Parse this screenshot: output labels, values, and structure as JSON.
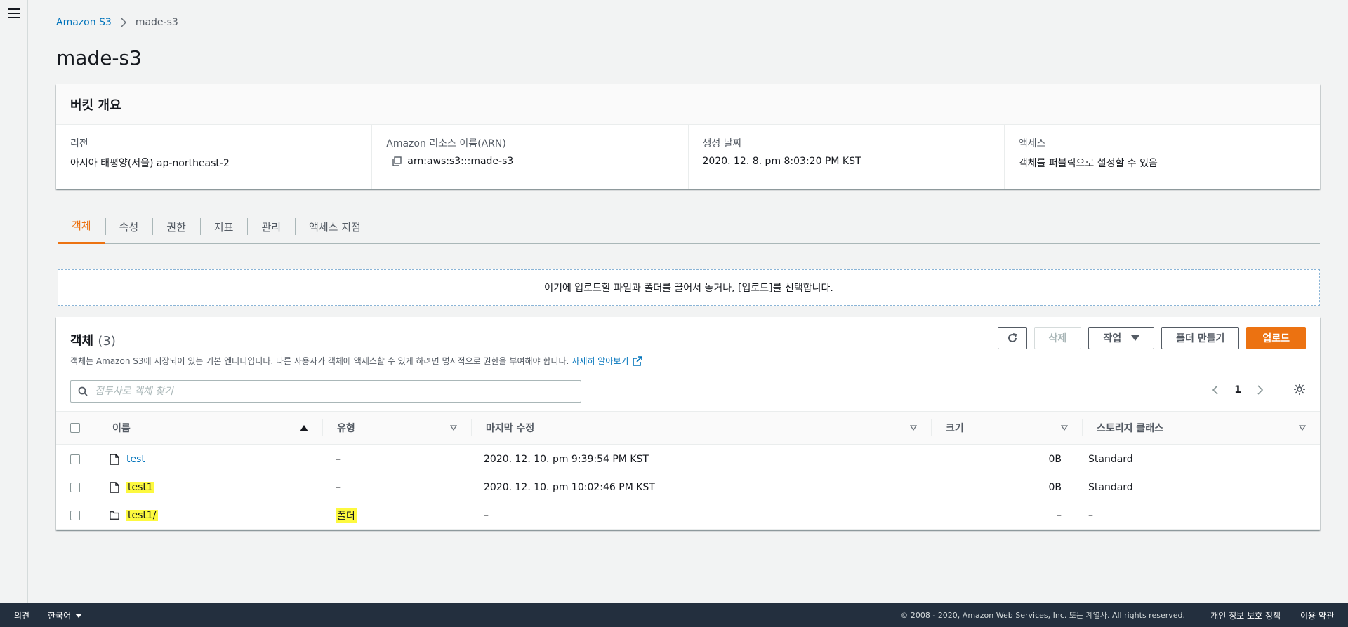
{
  "breadcrumb": {
    "root": "Amazon S3",
    "current": "made-s3"
  },
  "page_title": "made-s3",
  "overview": {
    "title": "버킷 개요",
    "region_label": "리전",
    "region_value": "아시아 태평양(서울) ap-northeast-2",
    "arn_label": "Amazon 리소스 이름(ARN)",
    "arn_value": "arn:aws:s3:::made-s3",
    "created_label": "생성 날짜",
    "created_value": "2020. 12. 8. pm 8:03:20 PM KST",
    "access_label": "액세스",
    "access_value": "객체를 퍼블릭으로 설정할 수 있음"
  },
  "tabs": [
    {
      "label": "객체",
      "active": true
    },
    {
      "label": "속성"
    },
    {
      "label": "권한"
    },
    {
      "label": "지표"
    },
    {
      "label": "관리"
    },
    {
      "label": "액세스 지점"
    }
  ],
  "dropzone_text": "여기에 업로드할 파일과 폴더를 끌어서 놓거나, [업로드]를 선택합니다.",
  "objects": {
    "title": "객체",
    "count": "(3)",
    "description": "객체는 Amazon S3에 저장되어 있는 기본 엔터티입니다. 다른 사용자가 객체에 액세스할 수 있게 하려면 명시적으로 권한을 부여해야 합니다.",
    "learn_more": "자세히 알아보기",
    "buttons": {
      "delete": "삭제",
      "actions": "작업",
      "create_folder": "폴더 만들기",
      "upload": "업로드"
    },
    "search_placeholder": "접두사로 객체 찾기",
    "page": "1",
    "columns": {
      "name": "이름",
      "type": "유형",
      "modified": "마지막 수정",
      "size": "크기",
      "storage": "스토리지 클래스"
    },
    "rows": [
      {
        "name": "test",
        "type": "–",
        "modified": "2020. 12. 10. pm 9:39:54 PM KST",
        "size": "0B",
        "storage": "Standard"
      },
      {
        "name": "test1",
        "type": "–",
        "modified": "2020. 12. 10. pm 10:02:46 PM KST",
        "size": "0B",
        "storage": "Standard"
      },
      {
        "name": "test1/",
        "type": "폴더",
        "modified": "–",
        "size": "–",
        "storage": "–"
      }
    ]
  },
  "footer": {
    "feedback": "의견",
    "language": "한국어",
    "copyright": "© 2008 - 2020, Amazon Web Services, Inc. 또는 계열사. All rights reserved.",
    "privacy": "개인 정보 보호 정책",
    "terms": "이용 약관"
  },
  "colors": {
    "accent": "#ec7211",
    "link": "#0073bb",
    "highlight": "#fdf93f",
    "footer_bg": "#232f3e"
  }
}
